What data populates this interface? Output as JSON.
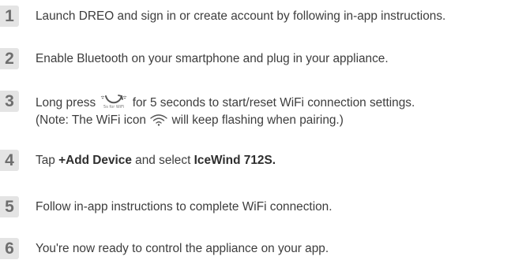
{
  "steps": [
    {
      "number": "1",
      "text": "Launch DREO and sign in or create account by following in-app instructions."
    },
    {
      "number": "2",
      "text": "Enable Bluetooth on your smartphone and plug in your appliance."
    },
    {
      "number": "3",
      "line1_before": "Long press ",
      "button_icon": "fan-wifi-button-icon",
      "line1_after": " for 5 seconds to start/reset WiFi connection settings.",
      "line2_before": "(Note: The WiFi icon ",
      "wifi_icon": "wifi-icon",
      "line2_after": " will keep flashing when pairing.)"
    },
    {
      "number": "4",
      "text_before": "Tap ",
      "bold_1": "+Add Device",
      "text_middle": " and select ",
      "bold_2": "IceWind 712S."
    },
    {
      "number": "5",
      "text": "Follow in-app instructions to complete WiFi connection."
    },
    {
      "number": "6",
      "text": "You're now ready to control the appliance on your app."
    }
  ]
}
